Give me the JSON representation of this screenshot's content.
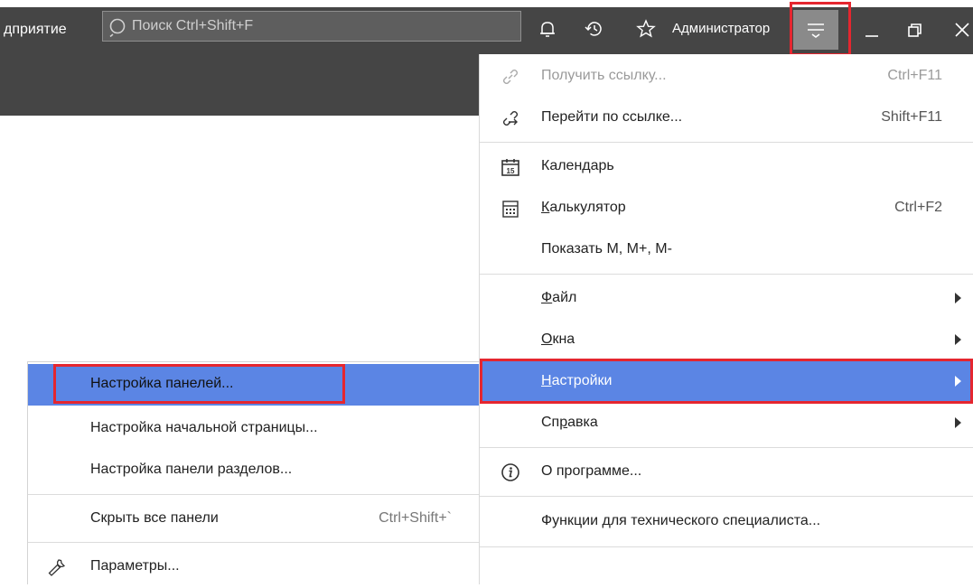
{
  "topbar": {
    "app_title": "дприятие",
    "search_placeholder": "Поиск Ctrl+Shift+F",
    "user_name": "Администратор",
    "icons": [
      "bell-icon",
      "history-icon",
      "star-icon",
      "hamburger-menu-icon",
      "minimize-icon",
      "restore-icon",
      "close-icon"
    ]
  },
  "main_menu": {
    "items": [
      {
        "label": "Получить ссылку...",
        "shortcut": "Ctrl+F11",
        "icon": "link-icon",
        "disabled": true
      },
      {
        "label": "Перейти по ссылке...",
        "shortcut": "Shift+F11",
        "icon": "goto-link-icon"
      },
      {
        "label": "Календарь",
        "shortcut": "",
        "icon": "calendar-icon",
        "icon_text": "15"
      },
      {
        "label_pre": "",
        "label_u": "К",
        "label_post": "алькулятор",
        "shortcut": "Ctrl+F2",
        "icon": "calculator-icon"
      },
      {
        "label": "Показать M, M+, M-",
        "shortcut": ""
      },
      {
        "label_pre": "",
        "label_u": "Ф",
        "label_post": "айл",
        "submenu": true
      },
      {
        "label_pre": "",
        "label_u": "О",
        "label_post": "кна",
        "submenu": true
      },
      {
        "label_pre": "",
        "label_u": "Н",
        "label_post": "астройки",
        "submenu": true,
        "active": true
      },
      {
        "label_pre": "Сп",
        "label_u": "р",
        "label_post": "авка",
        "submenu": true
      },
      {
        "label": "О программе...",
        "icon": "info-icon"
      },
      {
        "label": "Функции для технического специалиста..."
      }
    ]
  },
  "settings_submenu": {
    "items": [
      {
        "label": "Настройка панелей...",
        "active": true
      },
      {
        "label": "Настройка начальной страницы..."
      },
      {
        "label": "Настройка панели разделов..."
      },
      {
        "label": "Скрыть все панели",
        "shortcut": "Ctrl+Shift+`"
      },
      {
        "label": "Параметры...",
        "icon": "wrench-icon"
      }
    ]
  },
  "colors": {
    "topbar": "#454545",
    "highlight": "#5b85e4",
    "outline": "#e5262f"
  }
}
